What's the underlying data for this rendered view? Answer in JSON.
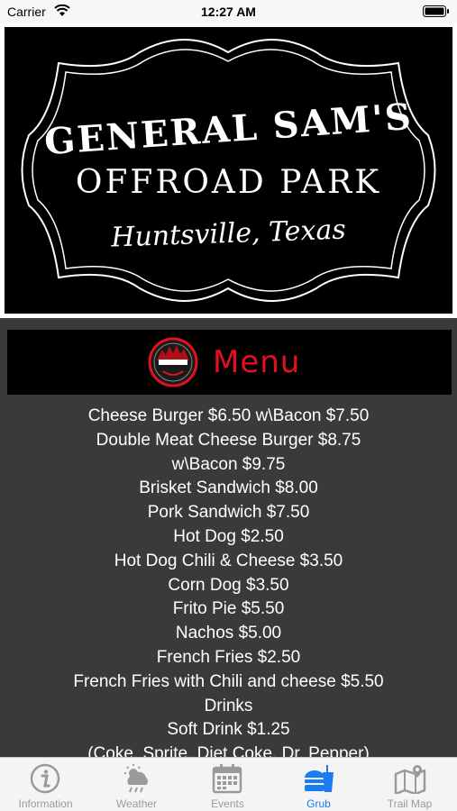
{
  "status_bar": {
    "carrier": "Carrier",
    "time": "12:27 AM"
  },
  "header_logo": {
    "line1": "GENERAL SAM'S",
    "line2": "OFFROAD PARK",
    "line3": "Huntsville, Texas"
  },
  "menu_header": {
    "badge_icon": "mud-grubbin-grill-logo",
    "title": "Menu",
    "title_color": "#e4101e"
  },
  "menu_items": [
    "Cheese Burger $6.50 w\\Bacon $7.50",
    "Double Meat Cheese Burger $8.75",
    "w\\Bacon $9.75",
    "Brisket Sandwich $8.00",
    "Pork Sandwich $7.50",
    "Hot Dog $2.50",
    "Hot Dog Chili & Cheese $3.50",
    "Corn Dog $3.50",
    "Frito Pie $5.50",
    "Nachos $5.00",
    "French Fries $2.50",
    "French Fries with Chili and cheese $5.50",
    "Drinks",
    "Soft Drink $1.25",
    "(Coke, Sprite, Diet Coke, Dr. Pepper)"
  ],
  "tab_bar": {
    "active_color": "#1a7cf2",
    "tabs": [
      {
        "label": "Information",
        "icon": "info-icon",
        "active": false
      },
      {
        "label": "Weather",
        "icon": "weather-icon",
        "active": false
      },
      {
        "label": "Events",
        "icon": "calendar-icon",
        "active": false
      },
      {
        "label": "Grub",
        "icon": "burger-icon",
        "active": true
      },
      {
        "label": "Trail Map",
        "icon": "map-icon",
        "active": false
      }
    ]
  }
}
